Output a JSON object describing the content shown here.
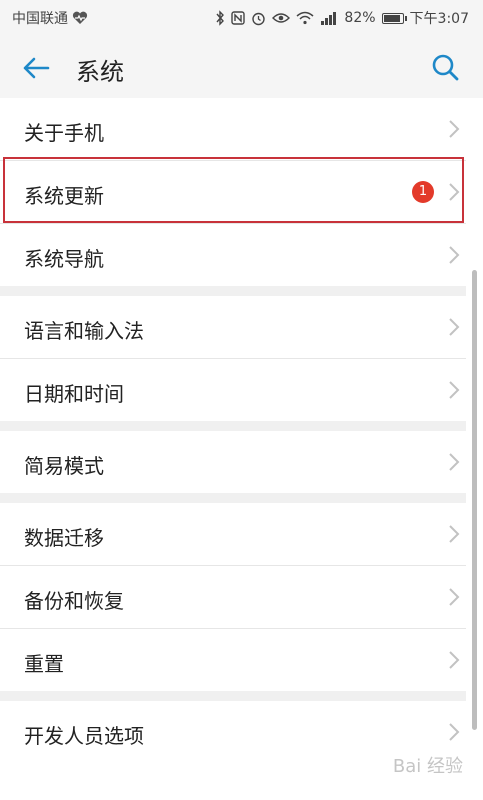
{
  "status_bar": {
    "carrier": "中国联通",
    "battery_percent": "82%",
    "time": "下午3:07",
    "icons": [
      "heart-pulse-icon",
      "bluetooth-icon",
      "nfc-icon",
      "alarm-icon",
      "eye-icon",
      "wifi-icon",
      "signal-icon",
      "battery-icon"
    ]
  },
  "header": {
    "title": "系统",
    "back_icon": "arrow-left-icon",
    "search_icon": "search-icon",
    "accent_color": "#1e88c8"
  },
  "groups": [
    {
      "items": [
        {
          "label": "关于手机"
        },
        {
          "label": "系统更新",
          "badge": "1",
          "highlighted": true
        },
        {
          "label": "系统导航"
        }
      ]
    },
    {
      "items": [
        {
          "label": "语言和输入法"
        },
        {
          "label": "日期和时间"
        }
      ]
    },
    {
      "items": [
        {
          "label": "简易模式"
        }
      ]
    },
    {
      "items": [
        {
          "label": "数据迁移"
        },
        {
          "label": "备份和恢复"
        },
        {
          "label": "重置"
        }
      ]
    },
    {
      "items": [
        {
          "label": "开发人员选项"
        }
      ]
    }
  ],
  "colors": {
    "badge": "#e33a2a",
    "highlight_border": "#c8323a"
  },
  "watermark": "Bai 经验"
}
